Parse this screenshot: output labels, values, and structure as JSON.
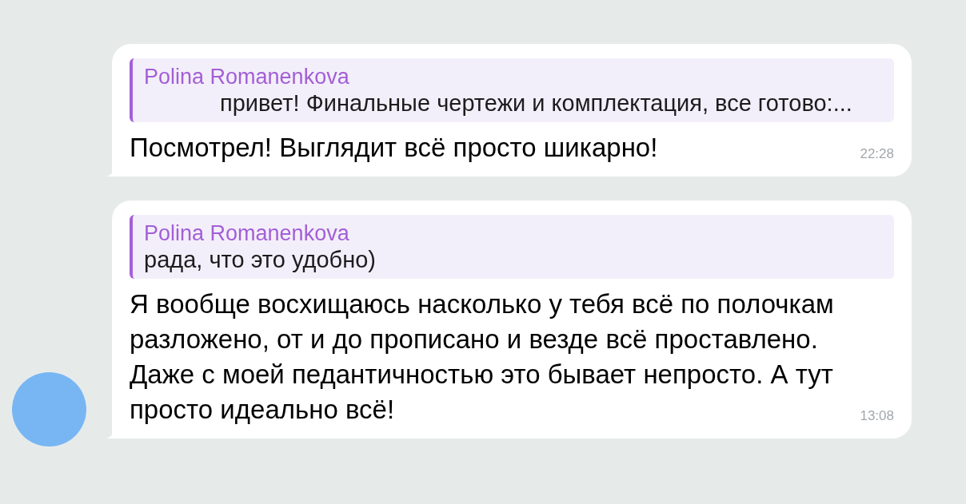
{
  "messages": [
    {
      "reply": {
        "author": "Polina Romanenkova",
        "text": "привет! Финальные чертежи и комплектация, все готово:..."
      },
      "text": "Посмотрел! Выглядит всё просто шикарно!",
      "time": "22:28",
      "avatar": false
    },
    {
      "reply": {
        "author": "Polina Romanenkova",
        "text": "рада, что это удобно)"
      },
      "text": "Я вообще восхищаюсь насколько у тебя всё по полочкам разложено, от и до прописано и везде всё проставлено. Даже с моей педантичностью это бывает непросто. А тут просто идеально всё!",
      "time": "13:08",
      "avatar": true
    }
  ]
}
